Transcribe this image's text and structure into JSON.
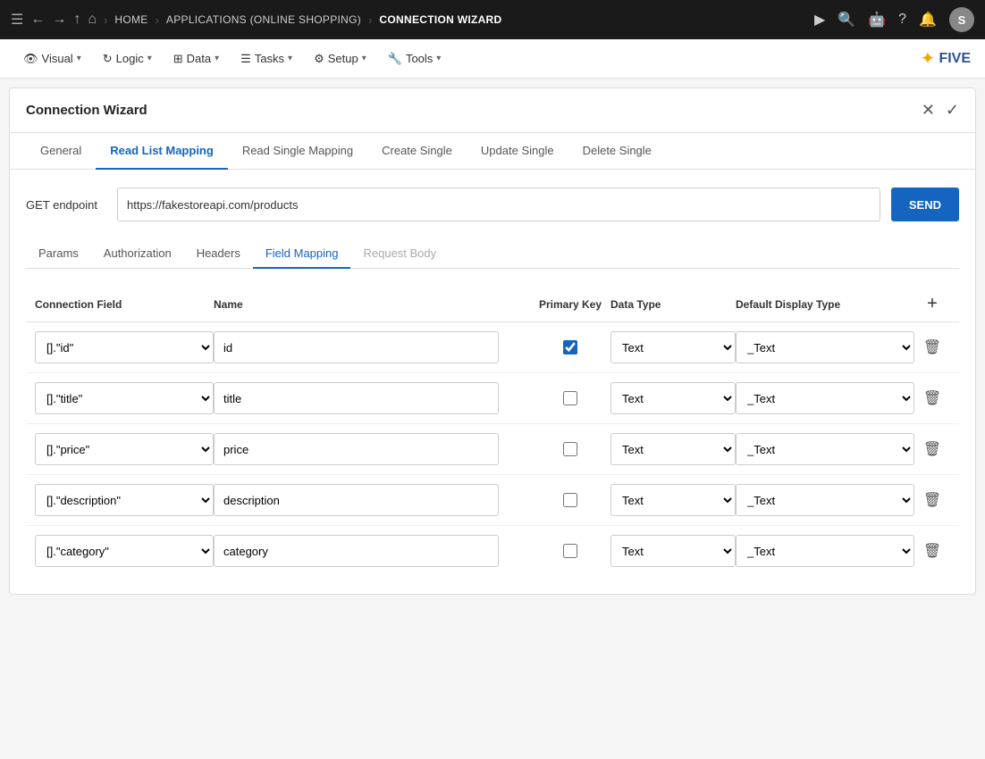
{
  "topbar": {
    "hamburger": "☰",
    "back_icon": "←",
    "forward_icon": "→",
    "up_icon": "↑",
    "home_icon": "⌂",
    "breadcrumbs": [
      {
        "label": "HOME",
        "active": false
      },
      {
        "label": "APPLICATIONS (ONLINE SHOPPING)",
        "active": false
      },
      {
        "label": "CONNECTION WIZARD",
        "active": true
      }
    ],
    "play_icon": "▶",
    "search_icon": "🔍",
    "robot_icon": "🤖",
    "help_icon": "?",
    "bell_icon": "🔔",
    "avatar_label": "S"
  },
  "toolbar2": {
    "items": [
      {
        "id": "visual",
        "label": "Visual",
        "has_caret": true
      },
      {
        "id": "logic",
        "label": "Logic",
        "has_caret": true
      },
      {
        "id": "data",
        "label": "Data",
        "has_caret": true
      },
      {
        "id": "tasks",
        "label": "Tasks",
        "has_caret": true
      },
      {
        "id": "setup",
        "label": "Setup",
        "has_caret": true
      },
      {
        "id": "tools",
        "label": "Tools",
        "has_caret": true
      }
    ],
    "logo_star": "✦",
    "logo_text": "FIVE"
  },
  "panel": {
    "title": "Connection Wizard",
    "close_label": "✕",
    "confirm_label": "✓"
  },
  "tabs": [
    {
      "id": "general",
      "label": "General",
      "active": false
    },
    {
      "id": "read-list-mapping",
      "label": "Read List Mapping",
      "active": true
    },
    {
      "id": "read-single-mapping",
      "label": "Read Single Mapping",
      "active": false
    },
    {
      "id": "create-single",
      "label": "Create Single",
      "active": false
    },
    {
      "id": "update-single",
      "label": "Update Single",
      "active": false
    },
    {
      "id": "delete-single",
      "label": "Delete Single",
      "active": false
    }
  ],
  "endpoint": {
    "label": "GET endpoint",
    "value": "https://fakestoreapi.com/products",
    "send_label": "SEND"
  },
  "sub_tabs": [
    {
      "id": "params",
      "label": "Params",
      "active": false
    },
    {
      "id": "authorization",
      "label": "Authorization",
      "active": false
    },
    {
      "id": "headers",
      "label": "Headers",
      "active": false
    },
    {
      "id": "field-mapping",
      "label": "Field Mapping",
      "active": true
    },
    {
      "id": "request-body",
      "label": "Request Body",
      "active": false,
      "disabled": true
    }
  ],
  "table": {
    "headers": {
      "connection_field": "Connection Field",
      "name": "Name",
      "primary_key": "Primary Key",
      "data_type": "Data Type",
      "default_display": "Default Display Type",
      "add_label": "+"
    },
    "rows": [
      {
        "id": "row-id",
        "connection_field": "[].\"id\"",
        "name": "id",
        "primary_key": true,
        "data_type": "Text",
        "display_type": "_Text"
      },
      {
        "id": "row-title",
        "connection_field": "[].\"title\"",
        "name": "title",
        "primary_key": false,
        "data_type": "Text",
        "display_type": "_Text"
      },
      {
        "id": "row-price",
        "connection_field": "[].\"price\"",
        "name": "price",
        "primary_key": false,
        "data_type": "Text",
        "display_type": "_Text"
      },
      {
        "id": "row-description",
        "connection_field": "[].\"description\"",
        "name": "description",
        "primary_key": false,
        "data_type": "Text",
        "display_type": "_Text"
      },
      {
        "id": "row-category",
        "connection_field": "[].\"category\"",
        "name": "category",
        "primary_key": false,
        "data_type": "Text",
        "display_type": "_Text"
      }
    ]
  }
}
